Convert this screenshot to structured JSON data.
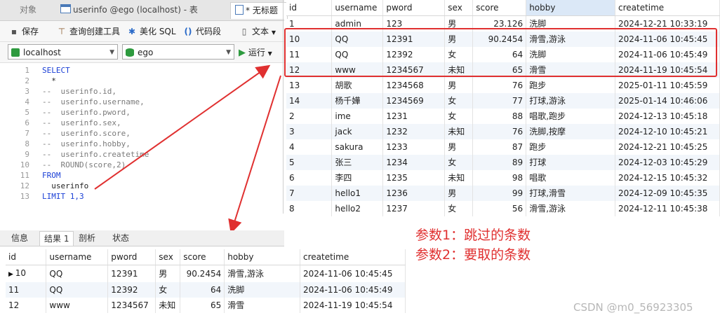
{
  "tabs": [
    {
      "label": "对象"
    },
    {
      "label": "userinfo @ego (localhost) - 表"
    },
    {
      "label": "* 无标题"
    }
  ],
  "toolbar": {
    "save": "保存",
    "query_builder": "查询创建工具",
    "beautify": "美化 SQL",
    "code_snippet": "代码段",
    "text": "文本"
  },
  "connection": {
    "value": "localhost"
  },
  "database": {
    "value": "ego"
  },
  "run": {
    "label": "运行"
  },
  "editor": {
    "lines": [
      {
        "no": "1",
        "text": "SELECT",
        "cls": "kw"
      },
      {
        "no": "2",
        "text": "  *",
        "cls": "tx"
      },
      {
        "no": "3",
        "text": "--  userinfo.id,",
        "cls": "cm"
      },
      {
        "no": "4",
        "text": "--  userinfo.username,",
        "cls": "cm"
      },
      {
        "no": "5",
        "text": "--  userinfo.pword,",
        "cls": "cm"
      },
      {
        "no": "6",
        "text": "--  userinfo.sex,",
        "cls": "cm"
      },
      {
        "no": "7",
        "text": "--  userinfo.score,",
        "cls": "cm"
      },
      {
        "no": "8",
        "text": "--  userinfo.hobby,",
        "cls": "cm"
      },
      {
        "no": "9",
        "text": "--  userinfo.createtime",
        "cls": "cm"
      },
      {
        "no": "10",
        "text": "--  ROUND(score,2)",
        "cls": "cm"
      },
      {
        "no": "11",
        "text": "FROM",
        "cls": "kw"
      },
      {
        "no": "12",
        "text": "  userinfo",
        "cls": "tx"
      },
      {
        "no": "13",
        "text": "LIMIT 1,3",
        "cls": "kw"
      }
    ]
  },
  "bottom_tabs": [
    {
      "label": "信息"
    },
    {
      "label": "结果 1"
    },
    {
      "label": "剖析"
    },
    {
      "label": "状态"
    }
  ],
  "columns": [
    "id",
    "username",
    "pword",
    "sex",
    "score",
    "hobby",
    "createtime"
  ],
  "full_table": [
    [
      "1",
      "admin",
      "123",
      "男",
      "23.126",
      "洗脚",
      "2024-12-21 10:33:19"
    ],
    [
      "10",
      "QQ",
      "12391",
      "男",
      "90.2454",
      "滑雪,游泳",
      "2024-11-06 10:45:45"
    ],
    [
      "11",
      "QQ",
      "12392",
      "女",
      "64",
      "洗脚",
      "2024-11-06 10:45:49"
    ],
    [
      "12",
      "www",
      "1234567",
      "未知",
      "65",
      "滑雪",
      "2024-11-19 10:45:54"
    ],
    [
      "13",
      "胡歌",
      "1234568",
      "男",
      "76",
      "跑步",
      "2025-01-11 10:45:59"
    ],
    [
      "14",
      "杨千嬅",
      "1234569",
      "女",
      "77",
      "打球,游泳",
      "2025-01-14 10:46:06"
    ],
    [
      "2",
      "ime",
      "1231",
      "女",
      "88",
      "唱歌,跑步",
      "2024-12-13 10:45:18"
    ],
    [
      "3",
      "jack",
      "1232",
      "未知",
      "76",
      "洗脚,按摩",
      "2024-12-10 10:45:21"
    ],
    [
      "4",
      "sakura",
      "1233",
      "男",
      "87",
      "跑步",
      "2024-12-21 10:45:25"
    ],
    [
      "5",
      "张三",
      "1234",
      "女",
      "89",
      "打球",
      "2024-12-03 10:45:29"
    ],
    [
      "6",
      "李四",
      "1235",
      "未知",
      "98",
      "唱歌",
      "2024-12-15 10:45:32"
    ],
    [
      "7",
      "hello1",
      "1236",
      "男",
      "99",
      "打球,滑雪",
      "2024-12-09 10:45:35"
    ],
    [
      "8",
      "hello2",
      "1237",
      "女",
      "56",
      "滑雪,游泳",
      "2024-12-11 10:45:38"
    ]
  ],
  "result_table": [
    [
      "10",
      "QQ",
      "12391",
      "男",
      "90.2454",
      "滑雪,游泳",
      "2024-11-06 10:45:45"
    ],
    [
      "11",
      "QQ",
      "12392",
      "女",
      "64",
      "洗脚",
      "2024-11-06 10:45:49"
    ],
    [
      "12",
      "www",
      "1234567",
      "未知",
      "65",
      "滑雪",
      "2024-11-19 10:45:54"
    ]
  ],
  "annotation": {
    "line1": "参数1：跳过的条数",
    "line2": "参数2：要取的条数",
    "color": "#e03030"
  },
  "watermark": "CSDN @m0_56923305"
}
